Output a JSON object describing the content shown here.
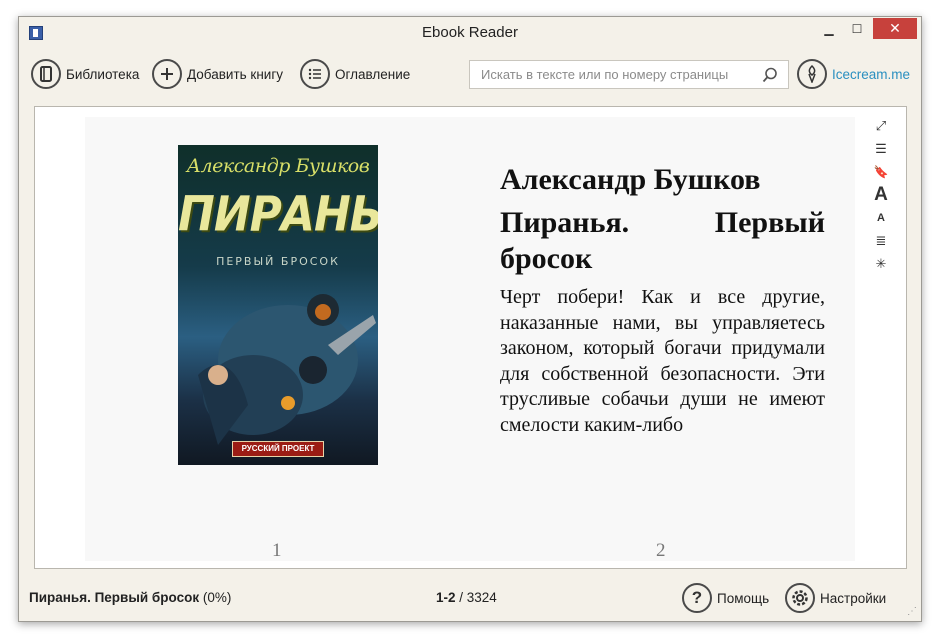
{
  "window": {
    "title": "Ebook Reader",
    "minimize_glyph": "▁",
    "maximize_glyph": "☐",
    "close_glyph": "✕"
  },
  "toolbar": {
    "library_label": "Библиотека",
    "add_book_label": "Добавить книгу",
    "contents_label": "Оглавление",
    "search_placeholder": "Искать в тексте или по номеру страницы",
    "icecream_label": "Icecream.me",
    "icons": [
      "book-icon",
      "plus-icon",
      "list-icon",
      "search-icon",
      "icecream-icon"
    ]
  },
  "book": {
    "cover": {
      "author": "Александр Бушков",
      "title": "ПИРАНЬЯ",
      "subtitle": "ПЕРВЫЙ БРОСОК",
      "badge": "РУССКИЙ ПРОЕКТ"
    },
    "author": "Александр Бушков",
    "title": "Пиранья. Первый бросок",
    "paragraph": "Черт побери! Как и все другие, наказанные нами, вы управляетесь законом, который богачи придумали для собственной безопасности. Эти трусливые собачьи души не имеют смелости каким-либо",
    "page_left": "1",
    "page_right": "2"
  },
  "side_tools": {
    "fullscreen": "⤢",
    "contents": "☰",
    "bookmark": "🔖",
    "font_increase": "A",
    "font_decrease": "A",
    "alignment": "≣",
    "night_mode": "✳"
  },
  "status": {
    "book_title": "Пиранья. Первый бросок",
    "progress": "(0%)",
    "current_pages": "1-2",
    "total_pages": "/ 3324",
    "help_label": "Помощь",
    "settings_label": "Настройки"
  },
  "colors": {
    "window_bg": "#f4f1e9",
    "close_button": "#c7413c",
    "link": "#2a8fc0"
  }
}
